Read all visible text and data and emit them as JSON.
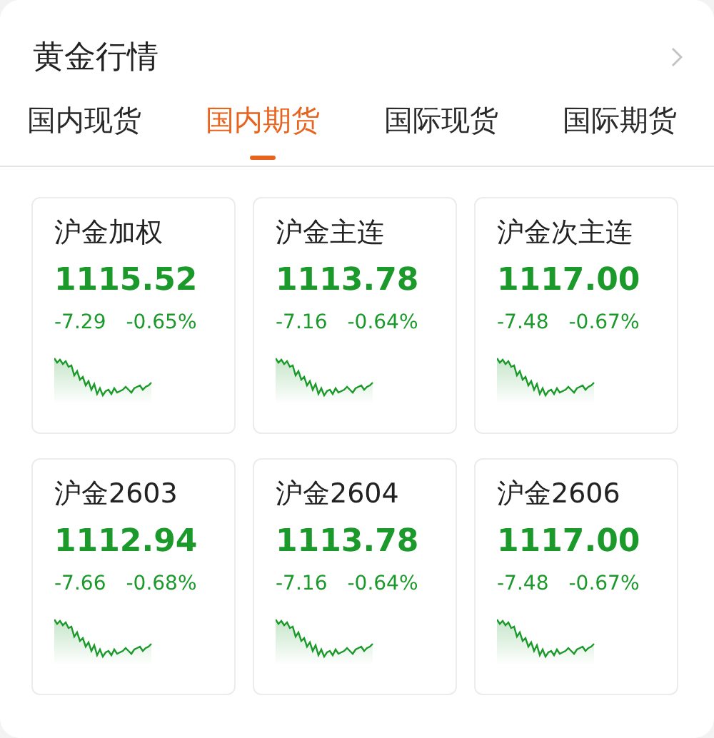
{
  "header": {
    "title": "黄金行情"
  },
  "tabs": [
    {
      "label": "国内现货",
      "selected": false
    },
    {
      "label": "国内期货",
      "selected": true
    },
    {
      "label": "国际现货",
      "selected": false
    },
    {
      "label": "国际期货",
      "selected": false
    }
  ],
  "quotes": [
    {
      "name": "沪金加权",
      "price": "1115.52",
      "change": "-7.29",
      "percent": "-0.65%"
    },
    {
      "name": "沪金主连",
      "price": "1113.78",
      "change": "-7.16",
      "percent": "-0.64%"
    },
    {
      "name": "沪金次主连",
      "price": "1117.00",
      "change": "-7.48",
      "percent": "-0.67%"
    },
    {
      "name": "沪金2603",
      "price": "1112.94",
      "change": "-7.66",
      "percent": "-0.68%"
    },
    {
      "name": "沪金2604",
      "price": "1113.78",
      "change": "-7.16",
      "percent": "-0.64%"
    },
    {
      "name": "沪金2606",
      "price": "1117.00",
      "change": "-7.48",
      "percent": "-0.67%"
    }
  ]
}
